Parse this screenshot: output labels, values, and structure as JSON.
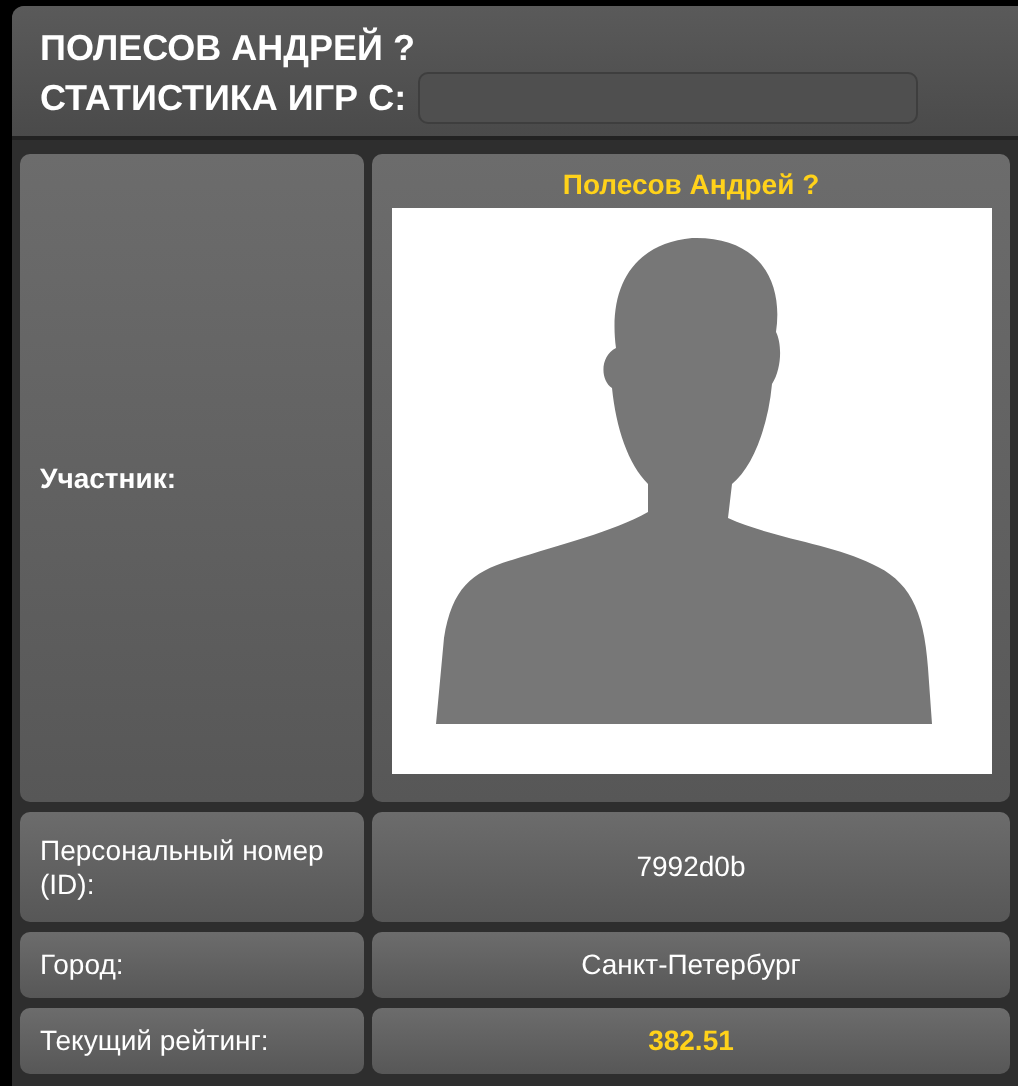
{
  "header": {
    "title": "ПОЛЕСОВ АНДРЕЙ ?",
    "stats_label": "СТАТИСТИКА ИГР С:"
  },
  "rows": [
    {
      "label": "Участник:",
      "name": "Полесов Андрей ?"
    },
    {
      "kind": "text",
      "label": "Персональный номер (ID):",
      "value": "7992d0b",
      "highlight": false
    },
    {
      "kind": "text",
      "label": "Город:",
      "value": "Санкт-Петербург",
      "highlight": false
    },
    {
      "kind": "text",
      "label": "Текущий рейтинг:",
      "value": "382.51",
      "highlight": true
    }
  ]
}
